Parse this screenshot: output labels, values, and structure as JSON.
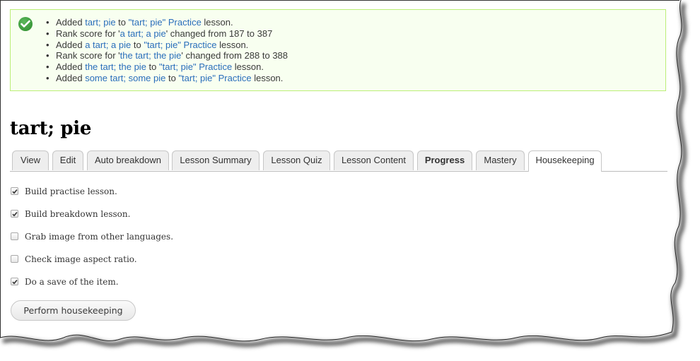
{
  "messages": {
    "icon": "check-circle-icon",
    "items": [
      {
        "parts": [
          {
            "text": "Added ",
            "link": false
          },
          {
            "text": "tart; pie",
            "link": true
          },
          {
            "text": " to ",
            "link": false
          },
          {
            "text": "\"tart; pie\" Practice",
            "link": true
          },
          {
            "text": " lesson.",
            "link": false
          }
        ]
      },
      {
        "parts": [
          {
            "text": "Rank score for '",
            "link": false
          },
          {
            "text": "a tart; a pie",
            "link": true
          },
          {
            "text": "' changed from 187 to 387",
            "link": false
          }
        ]
      },
      {
        "parts": [
          {
            "text": "Added ",
            "link": false
          },
          {
            "text": "a tart; a pie",
            "link": true
          },
          {
            "text": " to ",
            "link": false
          },
          {
            "text": "\"tart; pie\" Practice",
            "link": true
          },
          {
            "text": " lesson.",
            "link": false
          }
        ]
      },
      {
        "parts": [
          {
            "text": "Rank score for '",
            "link": false
          },
          {
            "text": "the tart; the pie",
            "link": true
          },
          {
            "text": "' changed from 288 to 388",
            "link": false
          }
        ]
      },
      {
        "parts": [
          {
            "text": "Added ",
            "link": false
          },
          {
            "text": "the tart; the pie",
            "link": true
          },
          {
            "text": " to ",
            "link": false
          },
          {
            "text": "\"tart; pie\" Practice",
            "link": true
          },
          {
            "text": " lesson.",
            "link": false
          }
        ]
      },
      {
        "parts": [
          {
            "text": "Added ",
            "link": false
          },
          {
            "text": "some tart; some pie",
            "link": true
          },
          {
            "text": " to ",
            "link": false
          },
          {
            "text": "\"tart; pie\" Practice",
            "link": true
          },
          {
            "text": " lesson.",
            "link": false
          }
        ]
      }
    ]
  },
  "page_title": "tart; pie",
  "tabs": [
    {
      "label": "View",
      "bold": false,
      "active": false
    },
    {
      "label": "Edit",
      "bold": false,
      "active": false
    },
    {
      "label": "Auto breakdown",
      "bold": false,
      "active": false
    },
    {
      "label": "Lesson Summary",
      "bold": false,
      "active": false
    },
    {
      "label": "Lesson Quiz",
      "bold": false,
      "active": false
    },
    {
      "label": "Lesson Content",
      "bold": false,
      "active": false
    },
    {
      "label": "Progress",
      "bold": true,
      "active": false
    },
    {
      "label": "Mastery",
      "bold": false,
      "active": false
    },
    {
      "label": "Housekeeping",
      "bold": false,
      "active": true
    }
  ],
  "options": [
    {
      "label": "Build practise lesson.",
      "checked": true
    },
    {
      "label": "Build breakdown lesson.",
      "checked": true
    },
    {
      "label": "Grab image from other languages.",
      "checked": false
    },
    {
      "label": "Check image aspect ratio.",
      "checked": false
    },
    {
      "label": "Do a save of the item.",
      "checked": true
    }
  ],
  "submit_button": {
    "label": "Perform housekeeping"
  }
}
